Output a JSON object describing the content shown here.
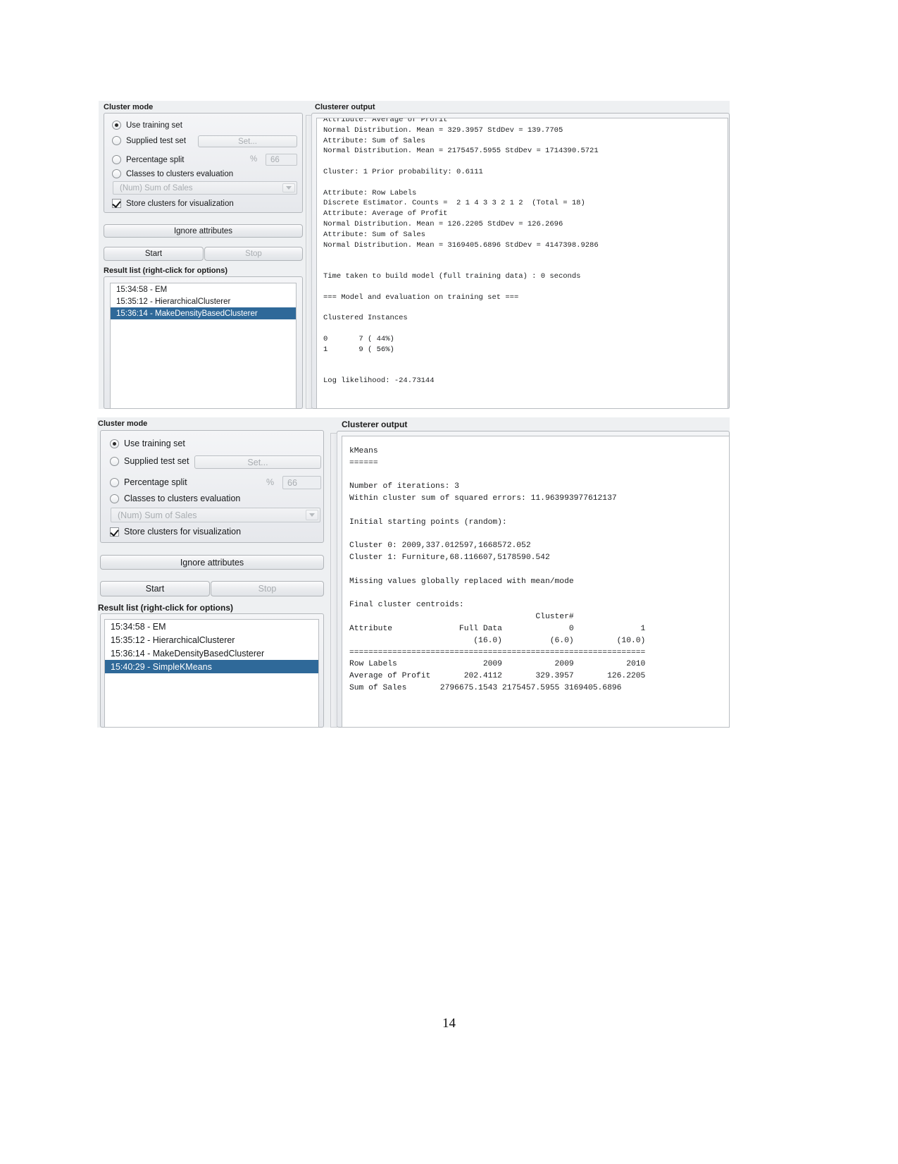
{
  "page": {
    "page_number": "14"
  },
  "panels": [
    {
      "id": "panel-em",
      "cluster_mode": {
        "title": "Cluster mode",
        "options": [
          {
            "label": "Use training set",
            "selected": true
          },
          {
            "label": "Supplied test set",
            "selected": false
          },
          {
            "label": "Percentage split",
            "selected": false
          },
          {
            "label": "Classes to clusters evaluation",
            "selected": false
          }
        ],
        "set_button": "Set...",
        "percent_symbol": "%",
        "percent_value": "66",
        "class_combo_value": "(Num) Sum of Sales",
        "store_clusters_label": "Store clusters for visualization",
        "store_clusters_checked": true
      },
      "ignore_attributes_button": "Ignore attributes",
      "start_button": "Start",
      "stop_button": "Stop",
      "result_list": {
        "title": "Result list (right-click for options)",
        "items": [
          {
            "label": "15:34:58 - EM",
            "selected": false
          },
          {
            "label": "15:35:12 - HierarchicalClusterer",
            "selected": false
          },
          {
            "label": "15:36:14 - MakeDensityBasedClusterer",
            "selected": true
          }
        ]
      },
      "output": {
        "title": "Clusterer output",
        "text": "Attribute: Average of Profit\nNormal Distribution. Mean = 329.3957 StdDev = 139.7705\nAttribute: Sum of Sales\nNormal Distribution. Mean = 2175457.5955 StdDev = 1714390.5721\n\nCluster: 1 Prior probability: 0.6111\n\nAttribute: Row Labels\nDiscrete Estimator. Counts =  2 1 4 3 3 2 1 2  (Total = 18)\nAttribute: Average of Profit\nNormal Distribution. Mean = 126.2205 StdDev = 126.2696\nAttribute: Sum of Sales\nNormal Distribution. Mean = 3169405.6896 StdDev = 4147398.9286\n\n\nTime taken to build model (full training data) : 0 seconds\n\n=== Model and evaluation on training set ===\n\nClustered Instances\n\n0       7 ( 44%)\n1       9 ( 56%)\n\n\nLog likelihood: -24.73144"
      }
    },
    {
      "id": "panel-kmeans",
      "cluster_mode": {
        "title": "Cluster mode",
        "options": [
          {
            "label": "Use training set",
            "selected": true
          },
          {
            "label": "Supplied test set",
            "selected": false
          },
          {
            "label": "Percentage split",
            "selected": false
          },
          {
            "label": "Classes to clusters evaluation",
            "selected": false
          }
        ],
        "set_button": "Set...",
        "percent_symbol": "%",
        "percent_value": "66",
        "class_combo_value": "(Num) Sum of Sales",
        "store_clusters_label": "Store clusters for visualization",
        "store_clusters_checked": true
      },
      "ignore_attributes_button": "Ignore attributes",
      "start_button": "Start",
      "stop_button": "Stop",
      "result_list": {
        "title": "Result list (right-click for options)",
        "items": [
          {
            "label": "15:34:58 - EM",
            "selected": false
          },
          {
            "label": "15:35:12 - HierarchicalClusterer",
            "selected": false
          },
          {
            "label": "15:36:14 - MakeDensityBasedClusterer",
            "selected": false
          },
          {
            "label": "15:40:29 - SimpleKMeans",
            "selected": true
          }
        ]
      },
      "output": {
        "title": "Clusterer output",
        "text": "kMeans\n======\n\nNumber of iterations: 3\nWithin cluster sum of squared errors: 11.963993977612137\n\nInitial starting points (random):\n\nCluster 0: 2009,337.012597,1668572.052\nCluster 1: Furniture,68.116607,5178590.542\n\nMissing values globally replaced with mean/mode\n\nFinal cluster centroids:\n                                       Cluster#\nAttribute              Full Data              0              1\n                          (16.0)          (6.0)         (10.0)\n==============================================================\nRow Labels                  2009           2009           2010\nAverage of Profit       202.4112       329.3957       126.2205\nSum of Sales       2796675.1543 2175457.5955 3169405.6896"
      }
    }
  ]
}
